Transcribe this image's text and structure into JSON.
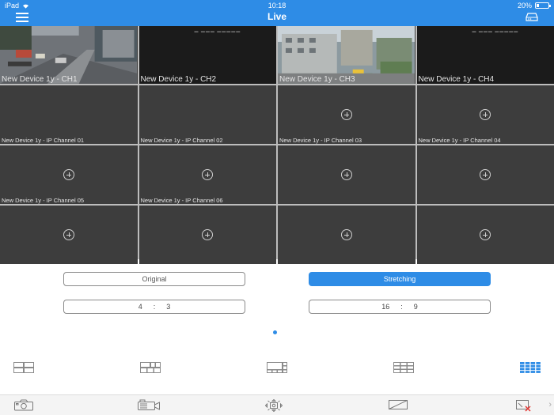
{
  "status_bar": {
    "device": "iPad",
    "time": "10:18",
    "battery": "20%"
  },
  "header": {
    "title": "Live"
  },
  "cells": [
    {
      "label": "New Device 1y - CH1",
      "kind": "video-street"
    },
    {
      "label": "New Device 1y - CH2",
      "kind": "video-dark"
    },
    {
      "label": "New Device 1y - CH3",
      "kind": "video-building"
    },
    {
      "label": "New Device 1y - CH4",
      "kind": "video-dark"
    },
    {
      "label": "New Device 1y - IP Channel 01",
      "kind": "empty"
    },
    {
      "label": "New Device 1y - IP Channel 02",
      "kind": "empty"
    },
    {
      "label": "New Device 1y - IP Channel 03",
      "kind": "add"
    },
    {
      "label": "New Device 1y - IP Channel 04",
      "kind": "add"
    },
    {
      "label": "New Device 1y - IP Channel 05",
      "kind": "add"
    },
    {
      "label": "New Device 1y - IP Channel 06",
      "kind": "add"
    },
    {
      "label": "",
      "kind": "add"
    },
    {
      "label": "",
      "kind": "add"
    },
    {
      "label": "",
      "kind": "add"
    },
    {
      "label": "",
      "kind": "add"
    },
    {
      "label": "",
      "kind": "add"
    },
    {
      "label": "",
      "kind": "add"
    }
  ],
  "controls": {
    "original_label": "Original",
    "stretching_label": "Stretching",
    "ratio_4_3": {
      "a": "4",
      "sep": ":",
      "b": "3"
    },
    "ratio_16_9": {
      "a": "16",
      "sep": ":",
      "b": "9"
    },
    "active_mode": "Stretching"
  },
  "layouts": [
    {
      "icon": "layout-2x2-icon",
      "selected": false
    },
    {
      "icon": "layout-1plus5-icon",
      "selected": false
    },
    {
      "icon": "layout-1plus7-icon",
      "selected": false
    },
    {
      "icon": "layout-3x3-icon",
      "selected": false
    },
    {
      "icon": "layout-4x4-icon",
      "selected": true
    }
  ],
  "toolbar": [
    "snapshot-camera-icon",
    "record-video-icon",
    "ptz-control-icon",
    "image-settings-icon",
    "close-all-icon"
  ],
  "colors": {
    "accent": "#2e8ce6",
    "cell_bg": "#3d3d3d",
    "grid_line": "#bdbdbd",
    "close_red": "#e53935"
  }
}
